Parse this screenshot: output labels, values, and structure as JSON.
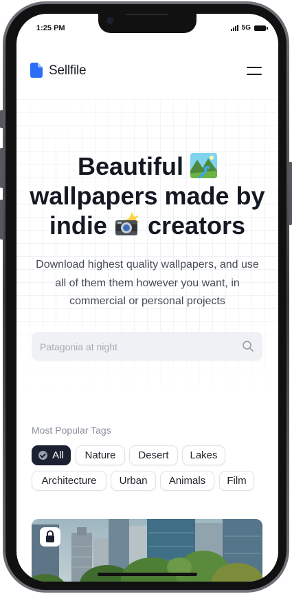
{
  "status_bar": {
    "time": "1:25 PM",
    "network": "5G"
  },
  "nav": {
    "brand": "Sellfile",
    "logo_icon": "file-icon",
    "menu_icon": "hamburger-menu-icon"
  },
  "hero": {
    "headline_line1": "Beautiful",
    "headline_emoji1": "national-park-emoji",
    "headline_line2": "wallpapers made by",
    "headline_line3_a": "indie",
    "headline_emoji2": "camera-with-flash-emoji",
    "headline_line3_b": "creators",
    "subtitle": "Download highest quality wallpapers, and use all of them them however you want, in commercial or personal projects"
  },
  "search": {
    "placeholder": "Patagonia at night",
    "icon": "search-icon"
  },
  "tags": {
    "title": "Most Popular Tags",
    "active": "All",
    "items": [
      "All",
      "Nature",
      "Desert",
      "Lakes",
      "Architecture",
      "Urban",
      "Animals",
      "Film"
    ]
  },
  "gallery": {
    "first_card_icon": "lock-icon"
  },
  "colors": {
    "accent": "#2b6ef5",
    "chip_active_bg": "#1b2130",
    "text_dark": "#141822"
  }
}
